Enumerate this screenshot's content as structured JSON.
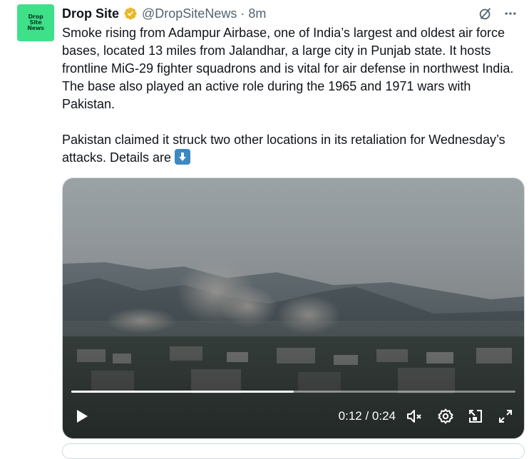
{
  "author": {
    "display_name": "Drop Site",
    "handle": "@DropSiteNews",
    "separator": "·",
    "time": "8m",
    "avatar_lines": [
      "Drop",
      "Site",
      "News"
    ]
  },
  "tweet": {
    "paragraph_1": "Smoke rising from Adampur Airbase, one of India’s largest and oldest air force bases, located 13 miles from Jalandhar, a large city in Punjab state. It hosts frontline MiG-29 fighter squadrons and is vital for air defense in northwest India. The base also played an active role during the 1965 and 1971 wars with Pakistan.",
    "paragraph_2": "Pakistan claimed it struck two other locations in its retaliation for Wednesday’s attacks. Details are",
    "emoji": "down-arrow-emoji"
  },
  "video": {
    "time_readout": "0:12 / 0:24",
    "progress_fraction": 0.5,
    "icons": [
      "play-icon",
      "mute-icon",
      "settings-icon",
      "pip-icon",
      "fullscreen-icon"
    ]
  },
  "colors": {
    "brand_avatar": "#3ee089",
    "verified_badge": "#e8b829",
    "muted_text": "#536471"
  }
}
